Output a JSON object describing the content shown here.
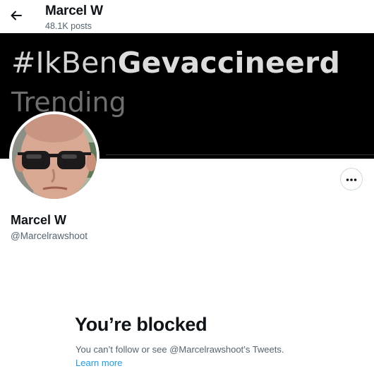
{
  "header": {
    "title": "Marcel W",
    "posts_count": "48.1K posts",
    "back_icon": "arrow-left-icon"
  },
  "banner": {
    "hashtag_prefix": "#IkBen",
    "hashtag_bold": "Gevaccineerd",
    "trending": "Trending",
    "background": "#000000"
  },
  "profile": {
    "name": "Marcel W",
    "handle": "@Marcelrawshoot",
    "avatar": "profile-photo",
    "more_icon": "more-horizontal-icon"
  },
  "blocked": {
    "title": "You’re blocked",
    "description": "You can’t follow or see @Marcelrawshoot’s Tweets.",
    "link": "Learn more",
    "link_color": "#1d9bf0"
  }
}
